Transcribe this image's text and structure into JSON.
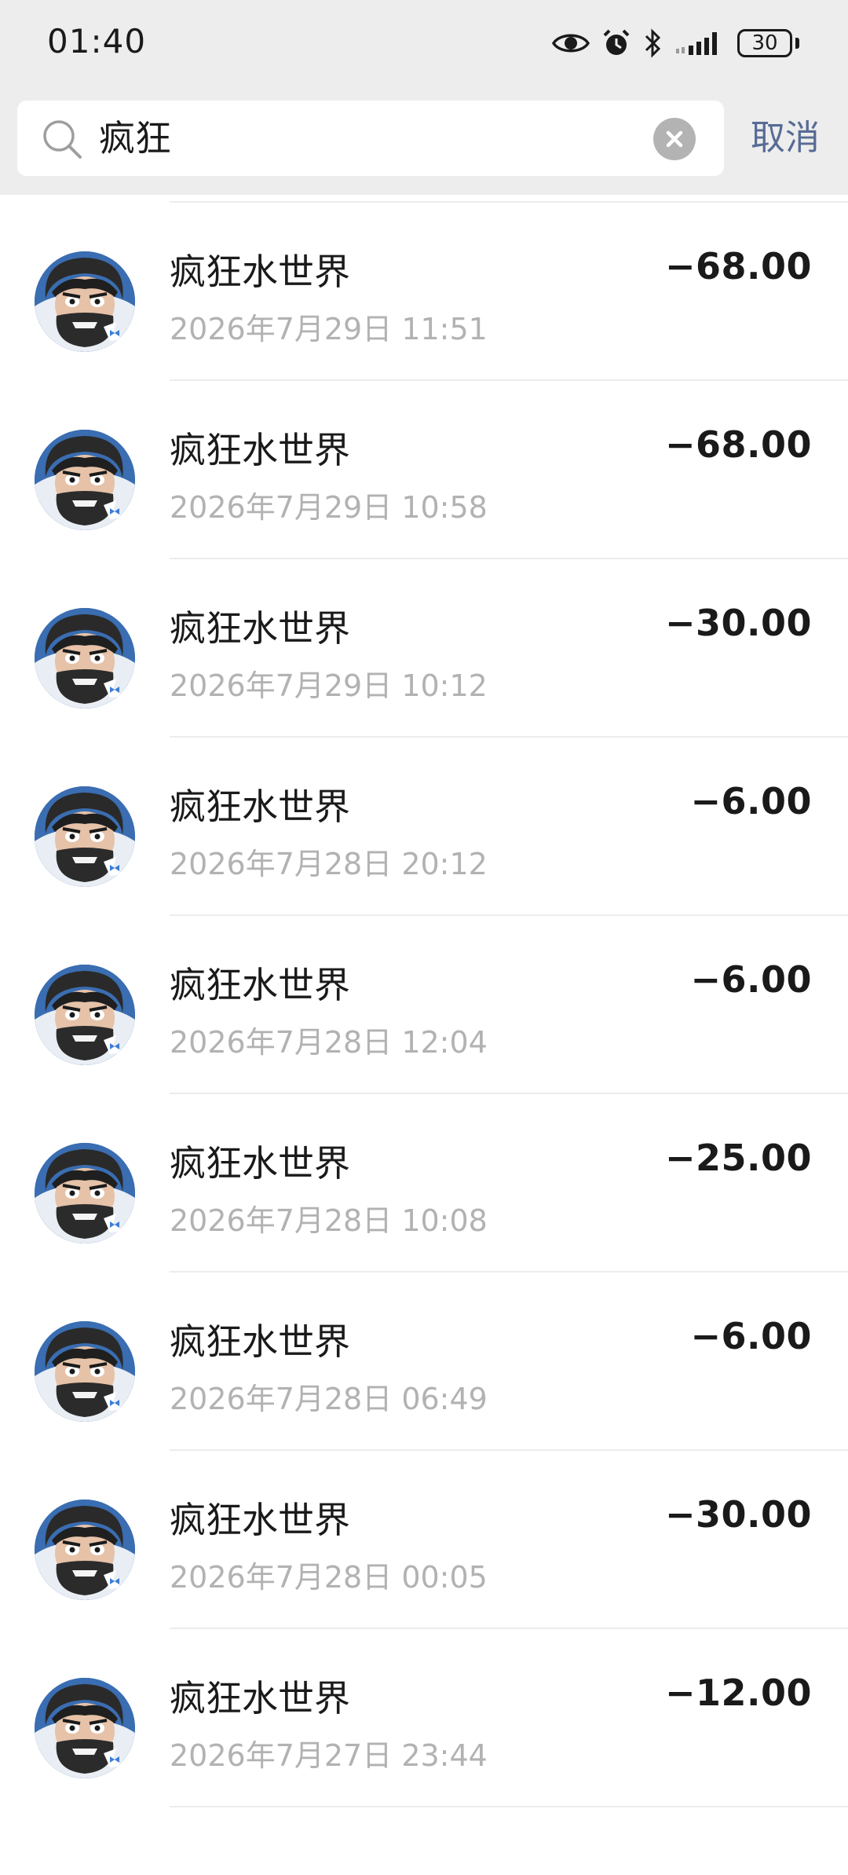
{
  "status_bar": {
    "time": "01:40",
    "battery": "30",
    "icons": [
      "eye-icon",
      "alarm-icon",
      "bluetooth-icon",
      "signal-icon",
      "battery-icon"
    ]
  },
  "search": {
    "query": "疯狂",
    "cancel_label": "取消",
    "icons": [
      "search-icon",
      "clear-icon"
    ]
  },
  "colors": {
    "header_bg": "#ededed",
    "link": "#576b95",
    "subtext": "#b2b2b2",
    "divider": "#ececec"
  },
  "transactions": [
    {
      "title": "疯狂水世界",
      "time": "2026年7月29日 11:51",
      "amount": "−68.00"
    },
    {
      "title": "疯狂水世界",
      "time": "2026年7月29日 10:58",
      "amount": "−68.00"
    },
    {
      "title": "疯狂水世界",
      "time": "2026年7月29日 10:12",
      "amount": "−30.00"
    },
    {
      "title": "疯狂水世界",
      "time": "2026年7月28日 20:12",
      "amount": "−6.00"
    },
    {
      "title": "疯狂水世界",
      "time": "2026年7月28日 12:04",
      "amount": "−6.00"
    },
    {
      "title": "疯狂水世界",
      "time": "2026年7月28日 10:08",
      "amount": "−25.00"
    },
    {
      "title": "疯狂水世界",
      "time": "2026年7月28日 06:49",
      "amount": "−6.00"
    },
    {
      "title": "疯狂水世界",
      "time": "2026年7月28日 00:05",
      "amount": "−30.00"
    },
    {
      "title": "疯狂水世界",
      "time": "2026年7月27日 23:44",
      "amount": "−12.00"
    }
  ]
}
